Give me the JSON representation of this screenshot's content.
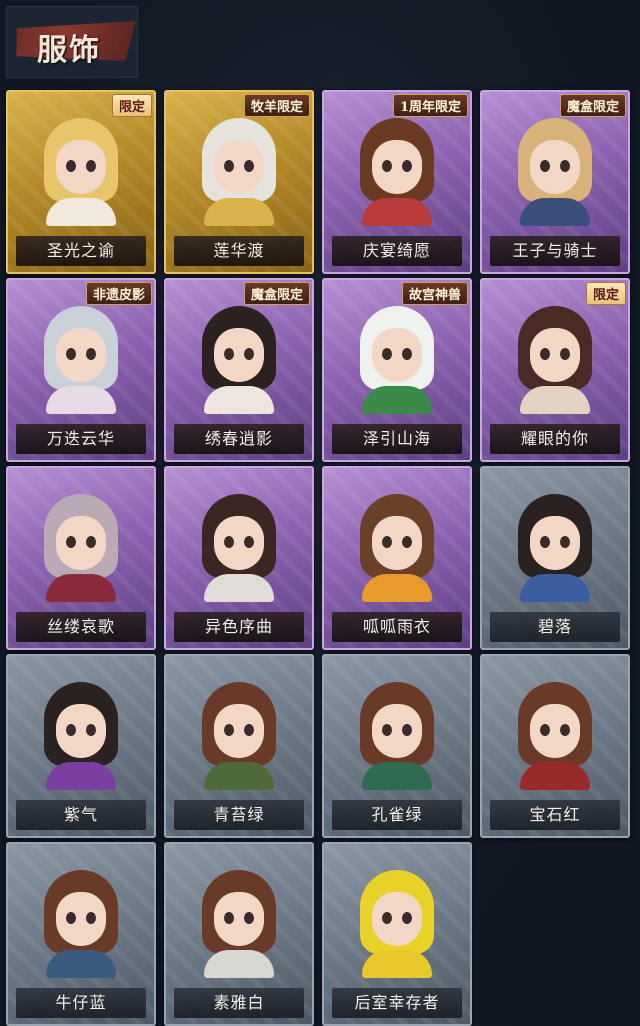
{
  "header": {
    "title": "服饰"
  },
  "colors": {
    "background": "#141b27",
    "gold_frame": "#d9b24a",
    "purple_frame": "#9a70bd",
    "gray_frame": "#7a8593",
    "banner": "#7a302a"
  },
  "costumes": [
    {
      "name": "圣光之谕",
      "rarity": "gold",
      "badge": "限定",
      "hair": "#e8c46a",
      "body": "#f1e9dc"
    },
    {
      "name": "莲华渡",
      "rarity": "gold",
      "badge": "牧羊限定",
      "hair": "#e6e2dc",
      "body": "#d9b24a"
    },
    {
      "name": "庆宴绮愿",
      "rarity": "purple",
      "badge": "1周年限定",
      "hair": "#6b3a22",
      "body": "#b83a3a"
    },
    {
      "name": "王子与骑士",
      "rarity": "purple",
      "badge": "魔盒限定",
      "hair": "#d9b27a",
      "body": "#3a4f7a"
    },
    {
      "name": "万迭云华",
      "rarity": "purple",
      "badge": "非遗皮影",
      "hair": "#c9d0d8",
      "body": "#e6dbe4"
    },
    {
      "name": "绣春逍影",
      "rarity": "purple",
      "badge": "魔盒限定",
      "hair": "#2a2220",
      "body": "#ede6e0"
    },
    {
      "name": "泽引山海",
      "rarity": "purple",
      "badge": "故宫神兽",
      "hair": "#eef1ee",
      "body": "#3c8a4a"
    },
    {
      "name": "耀眼的你",
      "rarity": "purple",
      "badge": "限定",
      "hair": "#4a2a24",
      "body": "#e3d3c2"
    },
    {
      "name": "丝缕哀歌",
      "rarity": "purple",
      "badge": "",
      "hair": "#b9aab6",
      "body": "#8a2a3a"
    },
    {
      "name": "异色序曲",
      "rarity": "purple",
      "badge": "",
      "hair": "#3a2622",
      "body": "#e2dcd8"
    },
    {
      "name": "呱呱雨衣",
      "rarity": "purple",
      "badge": "",
      "hair": "#6a4028",
      "body": "#e89a2a"
    },
    {
      "name": "碧落",
      "rarity": "gray",
      "badge": "",
      "hair": "#2a2220",
      "body": "#3a5ea0"
    },
    {
      "name": "紫气",
      "rarity": "gray",
      "badge": "",
      "hair": "#2a2220",
      "body": "#7a3fa0"
    },
    {
      "name": "青苔绿",
      "rarity": "gray",
      "badge": "",
      "hair": "#6a3a28",
      "body": "#4f6a3a"
    },
    {
      "name": "孔雀绿",
      "rarity": "gray",
      "badge": "",
      "hair": "#6a3a28",
      "body": "#2f6a52"
    },
    {
      "name": "宝石红",
      "rarity": "gray",
      "badge": "",
      "hair": "#6a3a28",
      "body": "#9a2a2a"
    },
    {
      "name": "牛仔蓝",
      "rarity": "gray",
      "badge": "",
      "hair": "#6a3a28",
      "body": "#3a5a80"
    },
    {
      "name": "素雅白",
      "rarity": "gray",
      "badge": "",
      "hair": "#6a3a28",
      "body": "#d8d8d2"
    },
    {
      "name": "后室幸存者",
      "rarity": "gray",
      "badge": "",
      "hair": "#e8d22a",
      "body": "#e8c82a"
    }
  ]
}
